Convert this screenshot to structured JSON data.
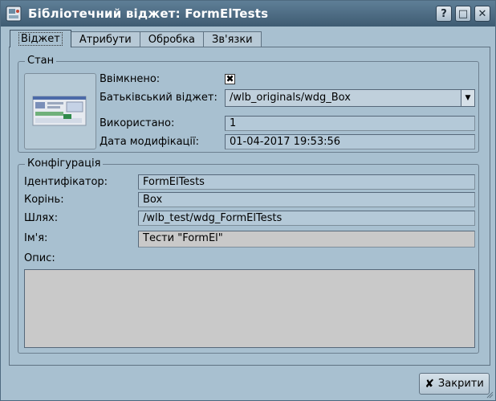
{
  "window": {
    "title": "Бібліотечний віджет: FormElTests",
    "help_label": "?",
    "maximize_label": "□",
    "close_label": "✕"
  },
  "tabs": [
    {
      "label": "Віджет",
      "active": true
    },
    {
      "label": "Атрибути",
      "active": false
    },
    {
      "label": "Обробка",
      "active": false
    },
    {
      "label": "Зв'язки",
      "active": false
    }
  ],
  "state": {
    "group_title": "Стан",
    "enabled_label": "Ввімкнено:",
    "enabled_mark": "✖",
    "parent_label": "Батьківський віджет:",
    "parent_value": "/wlb_originals/wdg_Box",
    "used_label": "Використано:",
    "used_value": "1",
    "modified_label": "Дата модифікації:",
    "modified_value": "01-04-2017 19:53:56"
  },
  "config": {
    "group_title": "Конфігурація",
    "id_label": "Ідентифікатор:",
    "id_value": "FormElTests",
    "root_label": "Корінь:",
    "root_value": "Box",
    "path_label": "Шлях:",
    "path_value": "/wlb_test/wdg_FormElTests",
    "name_label": "Ім'я:",
    "name_value": "Тести \"FormEl\"",
    "desc_label": "Опис:",
    "desc_value": ""
  },
  "footer": {
    "close_button_label": "Закрити",
    "close_icon_glyph": "✘"
  },
  "icons": {
    "app": "app-widget-icon",
    "preview": "widget-preview-thumbnail",
    "combo_arrow": "▼"
  },
  "colors": {
    "titlebar": "#4e6d85",
    "window_bg": "#a8c0d0",
    "editable_bg": "#c9c9c9"
  }
}
